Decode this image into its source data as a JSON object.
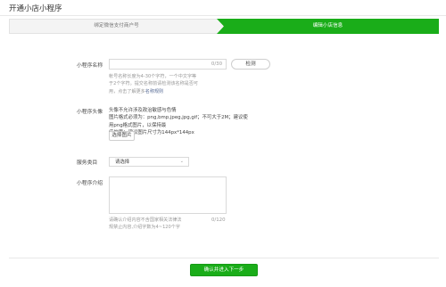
{
  "page": {
    "title": "开通小店小程序"
  },
  "steps": [
    {
      "label": "绑定微信支付商户号",
      "state": "done"
    },
    {
      "label": "编辑小店信息",
      "state": "active"
    }
  ],
  "colors": {
    "accent": "#1aad19",
    "link": "#576b95"
  },
  "name_field": {
    "label": "小程序名称",
    "value": "",
    "counter": "0/30",
    "check_button": "检测",
    "help": {
      "line1": "帐号名称长度为4-30个字符，一个中文字等",
      "line2": "于2个字符。提交名称前请检测该名称是否可",
      "line3_prefix": "用，点击了解更多",
      "line3_link": "名称规则"
    }
  },
  "avatar_field": {
    "label": "小程序头像",
    "line1": "头像不允许涉及政治敏感与色情",
    "line2": "图片格式必须为：png,bmp,jpeg,jpg,gif；不可大于2M；建议使用png格式图片，以保持最",
    "line3": "佳效果；建议图片尺寸为144px*144px",
    "select_button": "选择图片"
  },
  "category_field": {
    "label": "服务类目",
    "selected": "请选择",
    "chevron_icon": "chevron-down-icon"
  },
  "intro_field": {
    "label": "小程序介绍",
    "value": "",
    "counter": "0/120",
    "help_line1": "请确认介绍内容不含国家相关法律法",
    "help_line2": "规禁止内容,介绍字数为4~120个字"
  },
  "actions": {
    "submit": "确认并进入下一步"
  }
}
